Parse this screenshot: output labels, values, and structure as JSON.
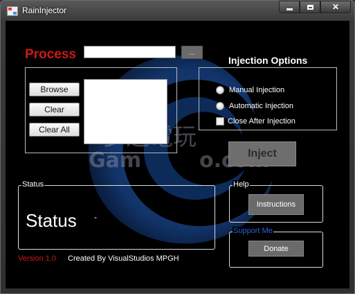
{
  "window": {
    "title": "RainInjector",
    "icons": {
      "app": "app-icon",
      "minimize": "minimize-icon",
      "maximize": "maximize-icon",
      "close": "close-icon"
    }
  },
  "process": {
    "label": "Process",
    "input_value": "",
    "browse_dots_label": "..."
  },
  "dll_list": {
    "browse_label": "Browse",
    "clear_label": "Clear",
    "clear_all_label": "Clear All",
    "items": []
  },
  "injection_options": {
    "title": "Injection Options",
    "manual_label": "Manual Injection",
    "automatic_label": "Automatic Injection",
    "close_after_label": "Close After Injection",
    "close_after_checked": false
  },
  "inject_button": {
    "label": "Inject",
    "enabled": false
  },
  "status": {
    "legend": "Status",
    "text": "Status",
    "detail": "-"
  },
  "help": {
    "legend": "Help",
    "instructions_label": "Instructions"
  },
  "support": {
    "legend": "Support Me",
    "donate_label": "Donate"
  },
  "footer": {
    "version": "Version 1.0",
    "credit": "Created By VisualStudios MPGH"
  },
  "watermark": {
    "cjk_text": "夢遊電玩",
    "latin_text": "Gam",
    "latin_text2": "o.com"
  },
  "colors": {
    "accent_red": "#d01818",
    "support_blue": "#2f5fd8",
    "background": "#000000"
  }
}
